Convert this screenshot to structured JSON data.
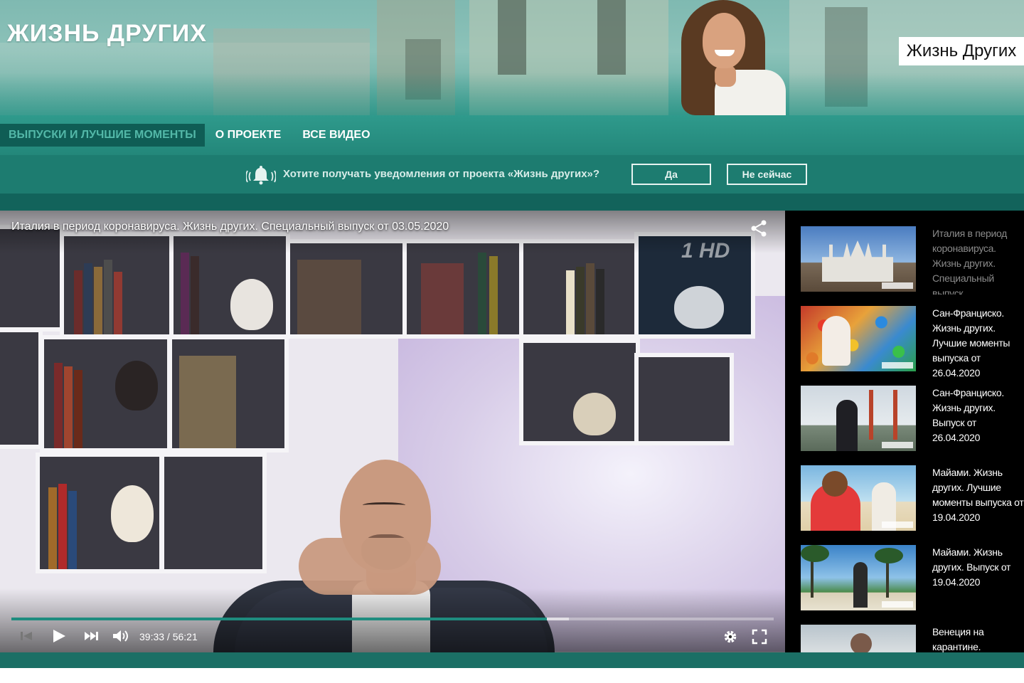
{
  "header": {
    "site_title": "ЖИЗНЬ ДРУГИХ",
    "logo_text": "Жизнь Других"
  },
  "nav": {
    "items": [
      {
        "label": "ВЫПУСКИ И ЛУЧШИЕ МОМЕНТЫ",
        "active": true
      },
      {
        "label": "О ПРОЕКТЕ",
        "active": false
      },
      {
        "label": "ВСЕ ВИДЕО",
        "active": false
      }
    ]
  },
  "notification": {
    "icon": "bell-icon",
    "text": "Хотите получать уведомления от проекта «Жизнь других»?",
    "yes_label": "Да",
    "no_label": "Не сейчас"
  },
  "player": {
    "title": "Италия в период коронавируса. Жизнь других. Специальный выпуск от 03.05.2020",
    "time": "39:33 / 56:21",
    "progress_fraction": 0.702,
    "buffered_fraction": 0.731,
    "controls": [
      "skip-back-icon",
      "play-icon",
      "skip-forward-icon",
      "volume-icon",
      "settings-gear-icon",
      "fullscreen-icon"
    ],
    "channel_logo": "1 HD"
  },
  "playlist": [
    {
      "title": "Италия в период коронавируса. Жизнь других. Специальный выпуск",
      "current": true,
      "thumb": "cathedral"
    },
    {
      "title": "Сан-Франциско. Жизнь других. Лучшие моменты выпуска от 26.04.2020",
      "current": false,
      "thumb": "balls"
    },
    {
      "title": "Сан-Франциско. Жизнь других. Выпуск от 26.04.2020",
      "current": false,
      "thumb": "bridge"
    },
    {
      "title": "Майами. Жизнь других. Лучшие моменты выпуска от 19.04.2020",
      "current": false,
      "thumb": "lifeguard"
    },
    {
      "title": "Майами. Жизнь других. Выпуск от 19.04.2020",
      "current": false,
      "thumb": "palms"
    },
    {
      "title": "Венеция на карантине.",
      "current": false,
      "thumb": "venice"
    }
  ],
  "colors": {
    "teal_nav": "#23877a",
    "teal_notify": "#1d7c70",
    "teal_dark": "#12635b",
    "progress": "#1e8c7e"
  }
}
